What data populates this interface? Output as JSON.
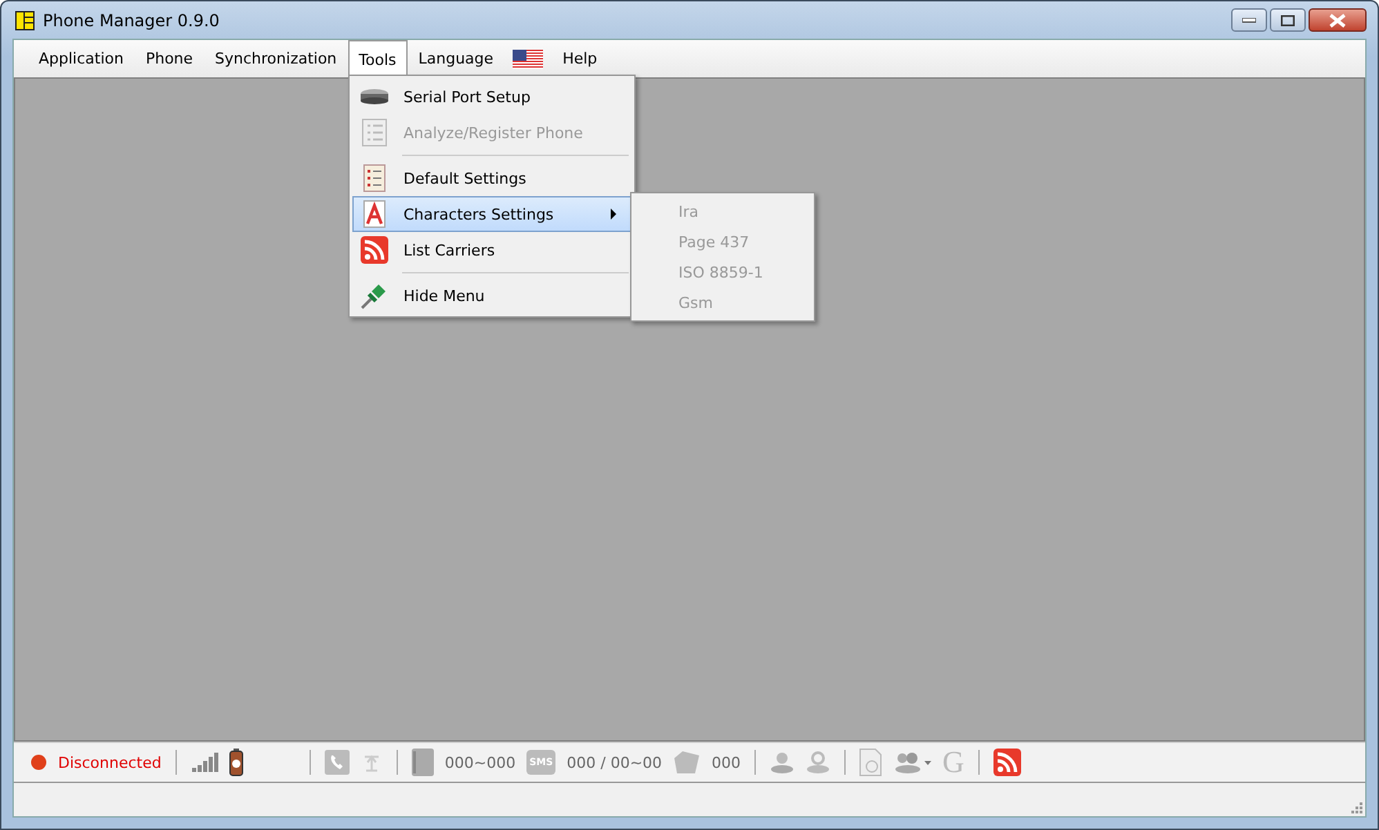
{
  "window": {
    "title": "Phone Manager 0.9.0"
  },
  "menu_bar": [
    {
      "label": "Application",
      "selected": false,
      "kind": "text"
    },
    {
      "label": "Phone",
      "selected": false,
      "kind": "text"
    },
    {
      "label": "Synchronization",
      "selected": false,
      "kind": "text"
    },
    {
      "label": "Tools",
      "selected": true,
      "kind": "text"
    },
    {
      "label": "Language",
      "selected": false,
      "kind": "text"
    },
    {
      "kind": "flag",
      "selected": false
    },
    {
      "label": "Help",
      "selected": false,
      "kind": "text"
    }
  ],
  "tools_menu": [
    {
      "kind": "item",
      "label": "Serial Port Setup",
      "disabled": false,
      "selected": false,
      "submenu": false
    },
    {
      "kind": "item",
      "label": "Analyze/Register Phone",
      "disabled": true,
      "selected": false,
      "submenu": false
    },
    {
      "kind": "separator"
    },
    {
      "kind": "item",
      "label": "Default Settings",
      "disabled": false,
      "selected": false,
      "submenu": false
    },
    {
      "kind": "item",
      "label": "Characters Settings",
      "disabled": false,
      "selected": true,
      "submenu": true
    },
    {
      "kind": "item",
      "label": "List Carriers",
      "disabled": false,
      "selected": false,
      "submenu": false
    },
    {
      "kind": "separator"
    },
    {
      "kind": "item",
      "label": "Hide Menu",
      "disabled": false,
      "selected": false,
      "submenu": false
    }
  ],
  "submenu": [
    {
      "label": "Ira",
      "disabled": true
    },
    {
      "label": "Page 437",
      "disabled": true
    },
    {
      "label": "ISO 8859-1",
      "disabled": true
    },
    {
      "label": "Gsm",
      "disabled": true
    }
  ],
  "status_bar": {
    "connection": "Disconnected",
    "contacts_count": "000~000",
    "sms_label": "SMS",
    "sms_count": "000 / 00~00",
    "calls_count": "000",
    "google_label": "G"
  }
}
